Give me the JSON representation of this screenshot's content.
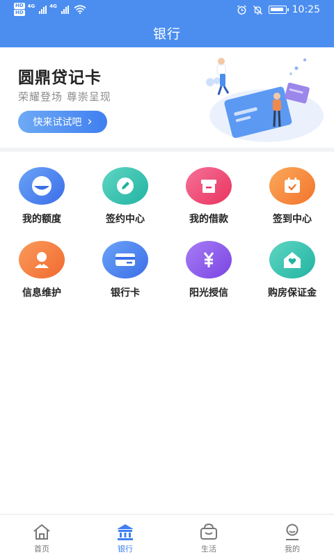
{
  "status_bar": {
    "hd1": "HD",
    "hd2": "HD",
    "net1": "4G",
    "net2": "4G",
    "time": "10:25"
  },
  "header": {
    "title": "银行"
  },
  "banner": {
    "title": "圆鼎贷记卡",
    "subtitle": "荣耀登场  尊崇呈现",
    "button_label": "快来试试吧",
    "button_arrow": "›"
  },
  "grid": [
    {
      "label": "我的额度",
      "icon": "quota-icon",
      "color_from": "#6aa3f7",
      "color_to": "#3b6ee8"
    },
    {
      "label": "签约中心",
      "icon": "pen-icon",
      "color_from": "#5fd6c3",
      "color_to": "#22b3a2"
    },
    {
      "label": "我的借款",
      "icon": "loan-box-icon",
      "color_from": "#f6719a",
      "color_to": "#e8345d"
    },
    {
      "label": "签到中心",
      "icon": "calendar-check-icon",
      "color_from": "#fba95a",
      "color_to": "#f2742c"
    },
    {
      "label": "信息维护",
      "icon": "user-icon",
      "color_from": "#fb9a5c",
      "color_to": "#f06a2f"
    },
    {
      "label": "银行卡",
      "icon": "bank-card-icon",
      "color_from": "#6aa3f7",
      "color_to": "#3b6ee8"
    },
    {
      "label": "阳光授信",
      "icon": "yuan-icon",
      "color_from": "#a67cf5",
      "color_to": "#7a45e3"
    },
    {
      "label": "购房保证金",
      "icon": "house-heart-icon",
      "color_from": "#5fd6c3",
      "color_to": "#22b3a2"
    }
  ],
  "tabs": [
    {
      "label": "首页",
      "icon": "home-icon",
      "active": false
    },
    {
      "label": "银行",
      "icon": "bank-icon",
      "active": true
    },
    {
      "label": "生活",
      "icon": "basket-icon",
      "active": false
    },
    {
      "label": "我的",
      "icon": "profile-icon",
      "active": false
    }
  ],
  "colors": {
    "primary": "#4b8ef0",
    "active_tab": "#3f7ff0",
    "inactive_tab": "#777777"
  }
}
